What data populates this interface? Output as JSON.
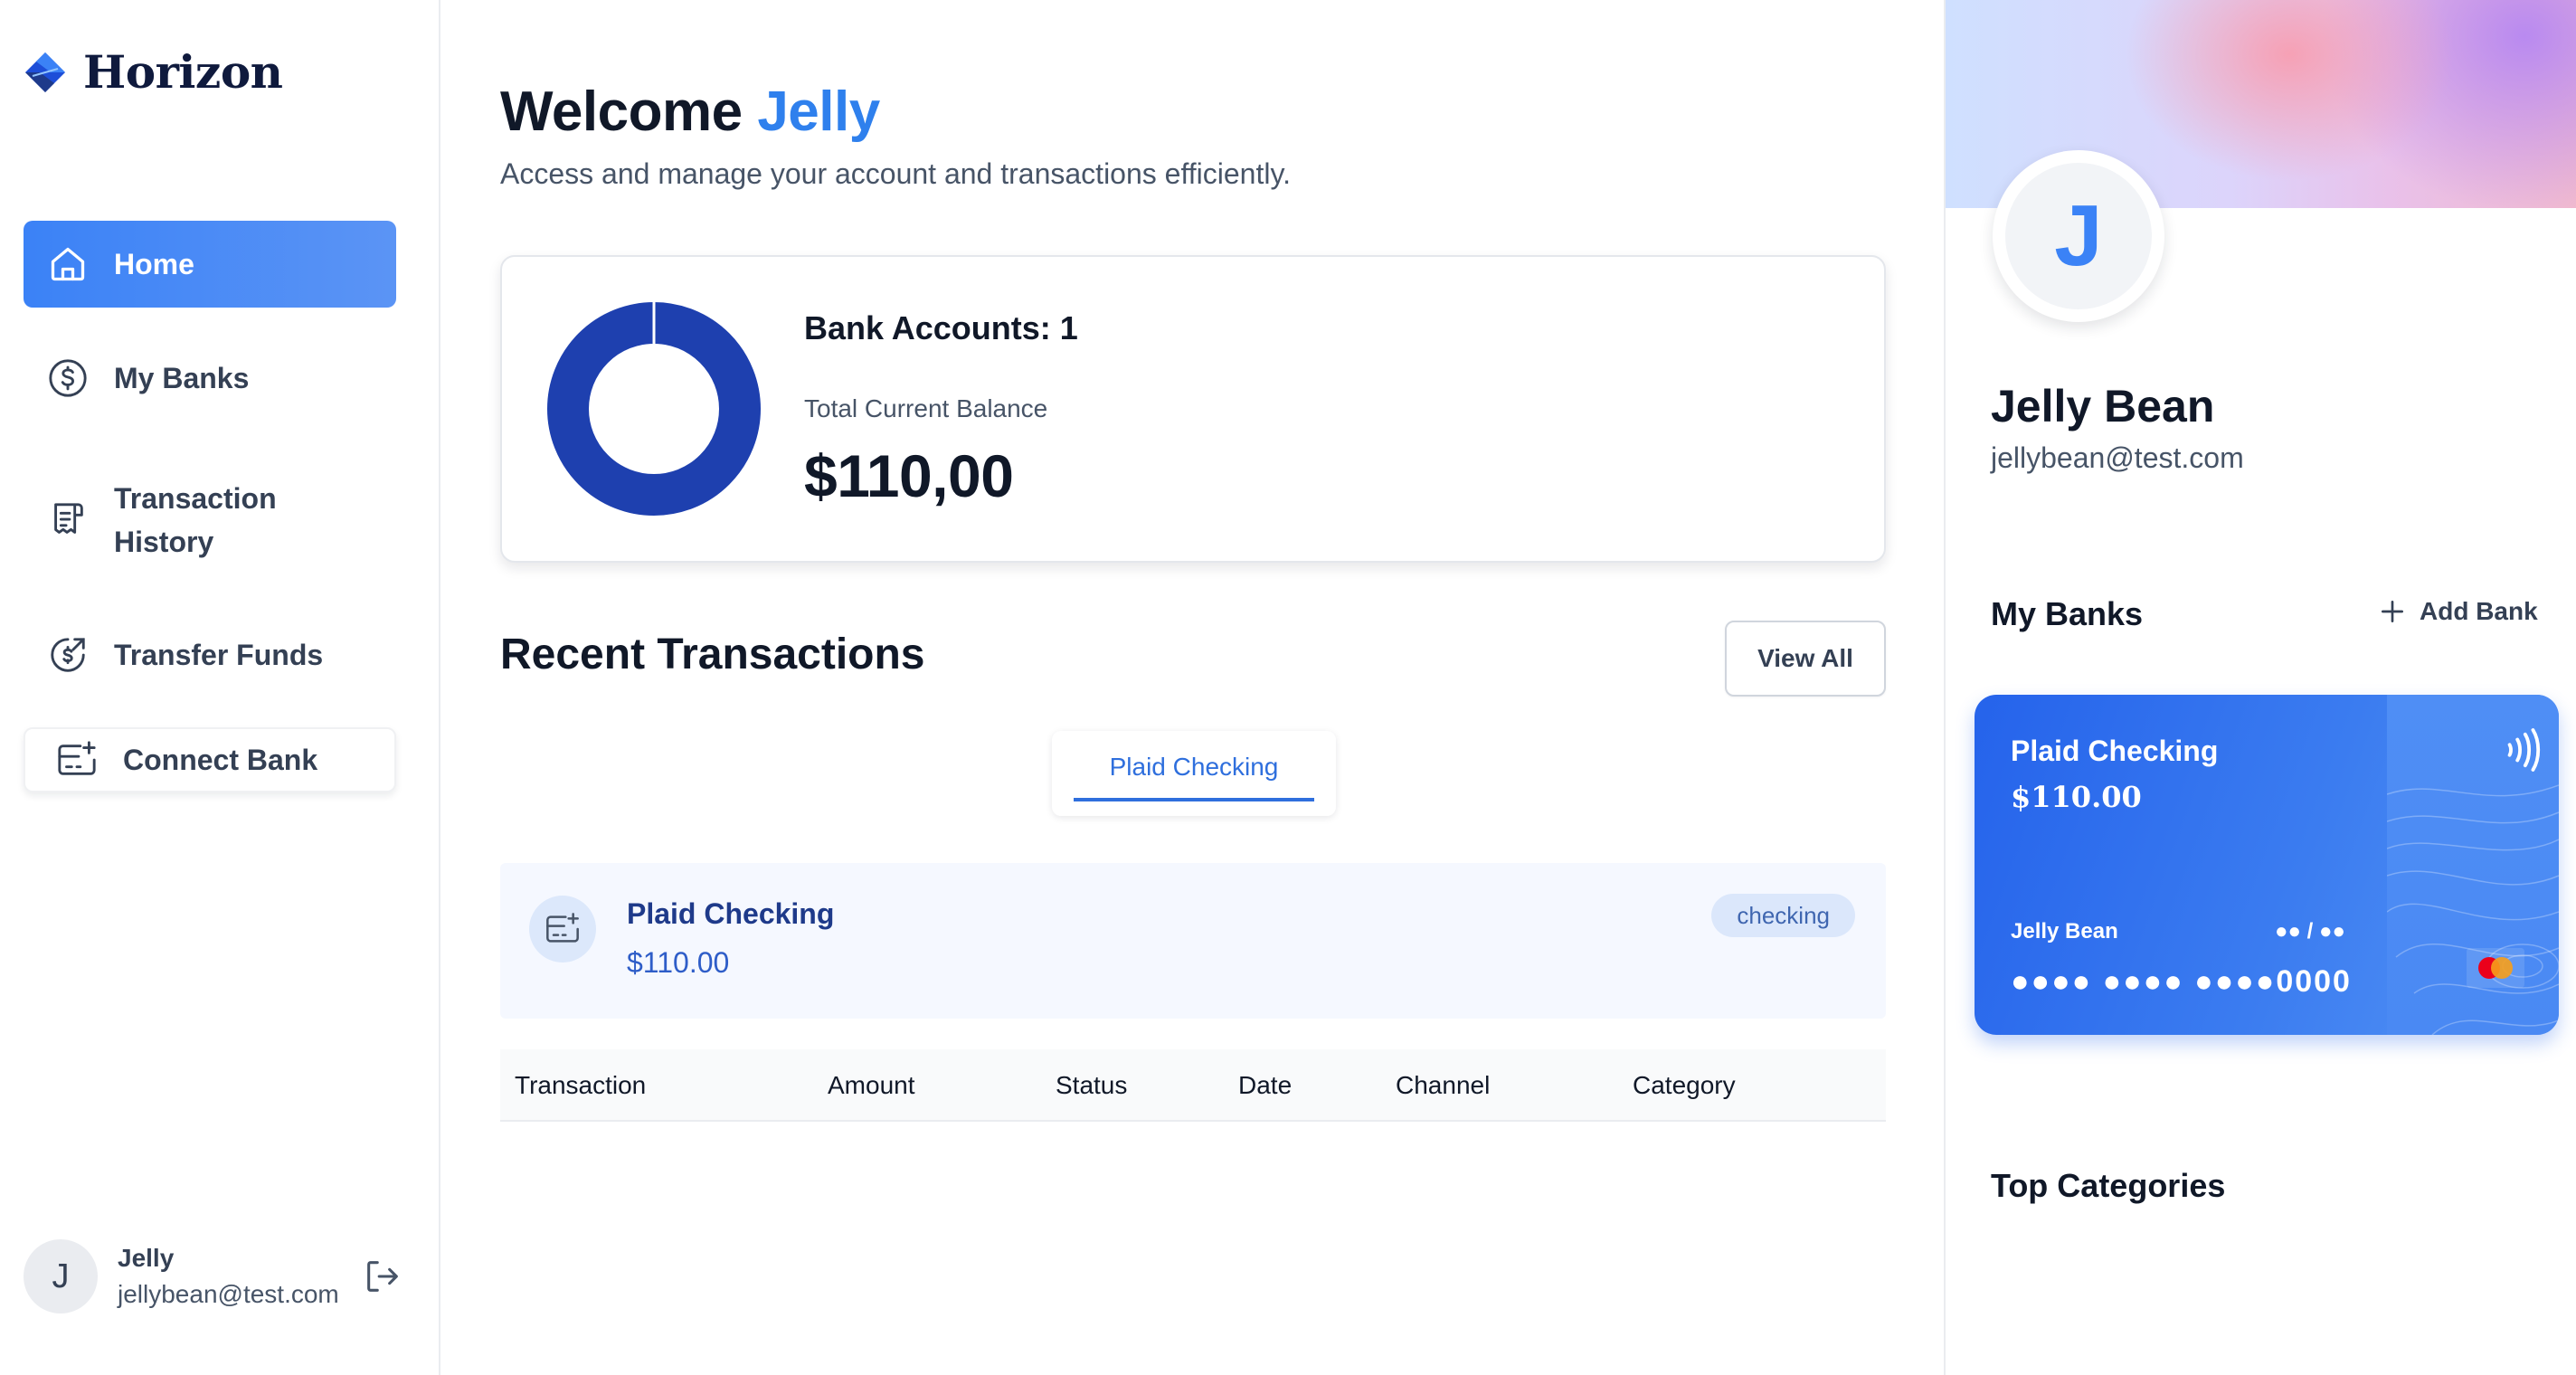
{
  "app": {
    "name": "Horizon",
    "colors": {
      "accent": "#3b82f6",
      "dark_blue": "#1e40af",
      "text": "#101828",
      "muted": "#475467"
    }
  },
  "sidebar": {
    "items": [
      {
        "label": "Home",
        "icon": "home-icon",
        "active": true
      },
      {
        "label": "My Banks",
        "icon": "dollar-circle-icon",
        "active": false
      },
      {
        "label": "Transaction History",
        "icon": "receipt-icon",
        "active": false
      },
      {
        "label": "Transfer Funds",
        "icon": "money-send-icon",
        "active": false
      }
    ],
    "connect_bank": {
      "label": "Connect Bank",
      "icon": "card-add-icon"
    },
    "user": {
      "initial": "J",
      "name": "Jelly",
      "email": "jellybean@test.com"
    }
  },
  "main": {
    "welcome_prefix": "Welcome",
    "welcome_name": "Jelly",
    "subtitle": "Access and manage your account and transactions efficiently.",
    "balance": {
      "bank_accounts_label": "Bank Accounts: 1",
      "total_label": "Total Current Balance",
      "total_value": "$110,00",
      "donut_color": "#1e40af"
    },
    "recent": {
      "title": "Recent Transactions",
      "view_all": "View All",
      "tabs": [
        {
          "label": "Plaid Checking",
          "active": true
        }
      ],
      "account": {
        "name": "Plaid Checking",
        "amount": "$110.00",
        "badge": "checking"
      },
      "columns": [
        "Transaction",
        "Amount",
        "Status",
        "Date",
        "Channel",
        "Category"
      ]
    }
  },
  "right_panel": {
    "profile": {
      "initial": "J",
      "name": "Jelly Bean",
      "email": "jellybean@test.com"
    },
    "my_banks_title": "My Banks",
    "add_bank": "Add Bank",
    "card": {
      "name": "Plaid Checking",
      "amount": "$110.00",
      "holder": "Jelly Bean",
      "expiry": "●● / ●●",
      "number": "●●●● ●●●● ●●●●0000"
    },
    "top_categories_title": "Top Categories"
  }
}
